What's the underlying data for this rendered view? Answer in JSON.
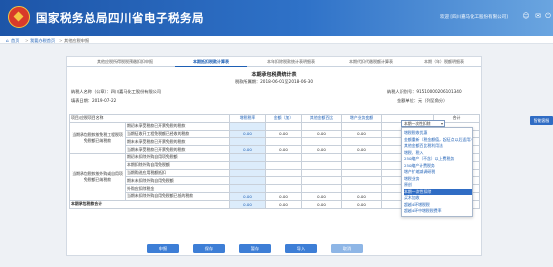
{
  "header": {
    "site_title": "国家税务总局四川省电子税务局",
    "welcome": "欢迎 [四川嘉马化工股份有限公司]"
  },
  "breadcrumb": [
    "首页",
    "我要办税首页",
    "其他应税申报"
  ],
  "tabs": [
    {
      "label": "其他应税所得税税预缴扣扣申报",
      "active": false
    },
    {
      "label": "本期抵扣税款计算表",
      "active": true
    },
    {
      "label": "本年扣除税款统计表明细表",
      "active": false
    },
    {
      "label": "本期代扣代缴税额计算表",
      "active": false
    },
    {
      "label": "本期（年）税额明细表",
      "active": false
    }
  ],
  "form": {
    "title": "本期承包税费统计表",
    "period": "税款所属期：2018-06-01至2018-06-30",
    "taxpayer_name": "纳税人名称（公章）：四川嘉马化工股份有限公司",
    "taxpayer_id": "纳税人识别号：91510000206101340",
    "fill_date": "填表日期：2019-07-22",
    "unit": "金额单位：元（列至角分）"
  },
  "table": {
    "headers": [
      "项目/应税项目名称",
      "",
      "增税税率",
      "金额（加）",
      "其他金额百比",
      "增产业务变额",
      "本期一次性扣除",
      "合计"
    ],
    "categories": [
      "当期承包税款按免税工程税项免税额已纳税款",
      "当期承包税款按外购或自用项免税额已纳税款"
    ],
    "rows": [
      {
        "label": "期初未享受税款已开票免税的税款",
        "values": [
          "",
          "",
          "",
          "",
          "",
          ""
        ]
      },
      {
        "label": "当期征收开工程免税额已经收的税款",
        "values": [
          "0.00",
          "0.00",
          "0.00",
          "0.00",
          "0.00",
          "0.00"
        ]
      },
      {
        "label": "期末未享受税款已开票免税的税款",
        "values": [
          "",
          "",
          "",
          "",
          "",
          ""
        ]
      },
      {
        "label": "当期未享受税款已开票免税的税款",
        "values": [
          "0.00",
          "0.00",
          "0.00",
          "0.00",
          "",
          "0.00"
        ]
      },
      {
        "label": "期初未扣除外购自用项免税额",
        "values": [
          "",
          "",
          "",
          "",
          "",
          ""
        ]
      },
      {
        "label": "本期扣除外购自用免税额",
        "values": [
          "",
          "",
          "",
          "",
          "",
          ""
        ]
      },
      {
        "label": "当期购进应用税额抵扣",
        "values": [
          "",
          "",
          "",
          "",
          "",
          ""
        ]
      },
      {
        "label": "期末未扣除外购自用免税额",
        "values": [
          "",
          "",
          "",
          "",
          "",
          ""
        ]
      },
      {
        "label": "外购应扣除税金",
        "values": [
          "",
          "",
          "",
          "",
          "",
          ""
        ]
      },
      {
        "label": "当期未扣除外购自用免税额已抵的税款",
        "values": [
          "0.00",
          "0.00",
          "0.00",
          "0.00",
          "",
          "0.00"
        ]
      },
      {
        "label": "本期承包税款合计",
        "values": [
          "0.00",
          "0.00",
          "0.00",
          "0.00",
          "",
          "0.00"
        ]
      }
    ]
  },
  "buttons": {
    "declare": "申报",
    "save": "保存",
    "temp": "暂存",
    "import": "导入",
    "cancel": "取消"
  },
  "dropdown": {
    "selected_value": "本期一次性扣除",
    "items": [
      {
        "label": "增税税收优惠",
        "selected": false
      },
      {
        "label": "金额重新（税金额值，起征点以后适用）",
        "selected": false
      },
      {
        "label": "其他金额百比税利用法",
        "selected": false
      },
      {
        "label": "增税、税入",
        "selected": false
      },
      {
        "label": "250缩产（不含）以上费税务",
        "selected": false
      },
      {
        "label": "250缩产计费税务",
        "selected": false
      },
      {
        "label": "增产扩缩减调研税",
        "selected": false
      },
      {
        "label": "增税业务",
        "selected": false
      },
      {
        "label": "原创",
        "selected": false
      },
      {
        "label": "本期一次性扣除",
        "selected": true
      },
      {
        "label": "买木加收",
        "selected": false
      },
      {
        "label": "超越4环增税税",
        "selected": false
      },
      {
        "label": "超越4环中增税税费率",
        "selected": false
      }
    ]
  },
  "side_button": "智能客服"
}
